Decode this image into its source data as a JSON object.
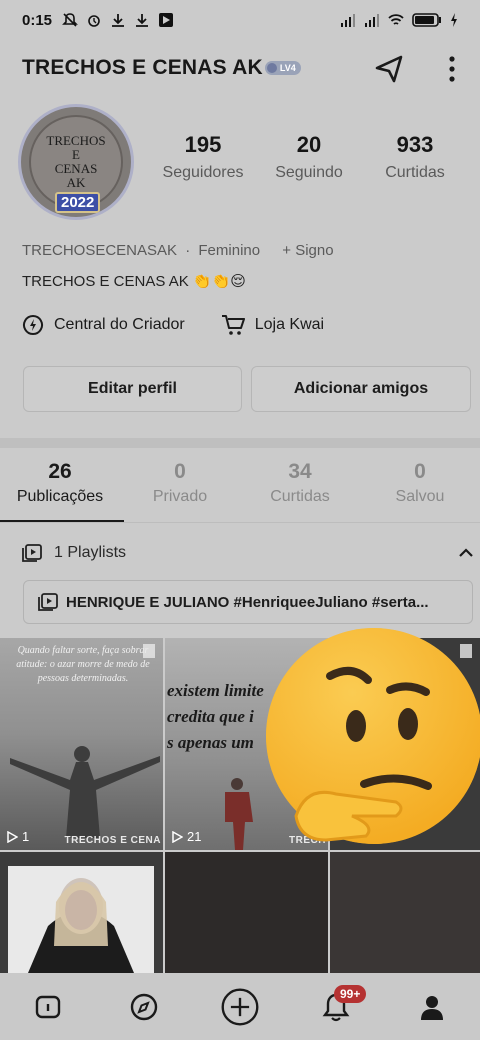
{
  "status_bar": {
    "time": "0:15"
  },
  "header": {
    "title": "TRECHOS E CENAS AK",
    "level": "LV4"
  },
  "avatar": {
    "lines": [
      "TRECHOS",
      "E",
      "CENAS",
      "AK"
    ],
    "year": "2022"
  },
  "stats": [
    {
      "count": "195",
      "label": "Seguidores"
    },
    {
      "count": "20",
      "label": "Seguindo"
    },
    {
      "count": "933",
      "label": "Curtidas"
    }
  ],
  "meta": {
    "username": "TRECHOSECENASAK",
    "separator": "·",
    "gender": "Feminino",
    "sign": "+ Signo"
  },
  "bio": "TRECHOS E CENAS AK 👏👏😌",
  "creator": {
    "center": "Central do Criador",
    "shop": "Loja Kwai"
  },
  "buttons": {
    "edit": "Editar perfil",
    "add": "Adicionar amigos"
  },
  "tabs": [
    {
      "count": "26",
      "label": "Publicações",
      "active": true
    },
    {
      "count": "0",
      "label": "Privado"
    },
    {
      "count": "34",
      "label": "Curtidas"
    },
    {
      "count": "0",
      "label": "Salvou"
    }
  ],
  "playlists": {
    "header": "1 Playlists",
    "item": "HENRIQUE E JULIANO #HenriqueeJuliano #serta..."
  },
  "grid": {
    "c1": {
      "quote": "Quando faltar sorte, faça sobrar atitude: o azar morre de medo de pessoas determinadas.",
      "views": "1",
      "watermark": "TRECHOS E CENA"
    },
    "c2": {
      "quote_lines": [
        "existem limite",
        "credita que i",
        "s apenas um"
      ],
      "views": "21",
      "watermark": "TRECH"
    }
  },
  "nav": {
    "badge": "99+"
  },
  "colors": {
    "badge": "#b53232",
    "emoji": "#f6b52a"
  }
}
